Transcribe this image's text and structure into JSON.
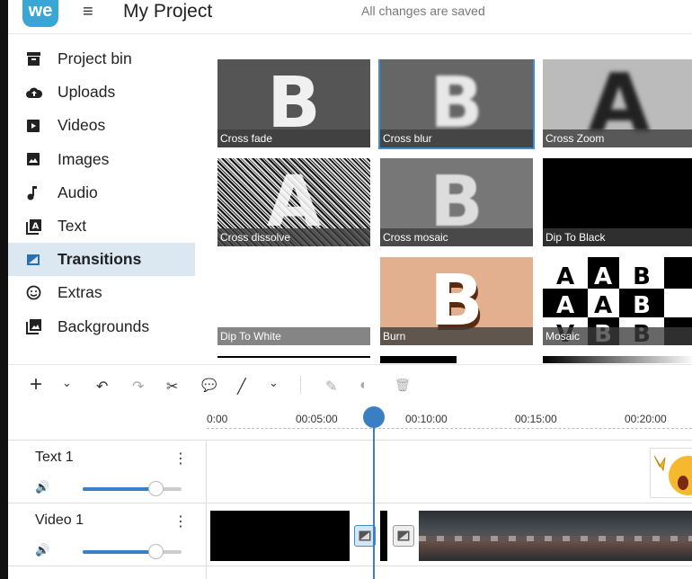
{
  "header": {
    "logo_text": "we",
    "menu_icon": "≡",
    "project_title": "My Project",
    "save_status": "All changes are saved"
  },
  "sidebar": {
    "items": [
      {
        "label": "Project bin",
        "icon": "archive-icon"
      },
      {
        "label": "Uploads",
        "icon": "cloud-upload-icon"
      },
      {
        "label": "Videos",
        "icon": "video-play-icon"
      },
      {
        "label": "Images",
        "icon": "image-icon"
      },
      {
        "label": "Audio",
        "icon": "music-note-icon"
      },
      {
        "label": "Text",
        "icon": "text-box-icon"
      },
      {
        "label": "Transitions",
        "icon": "transition-icon",
        "active": true
      },
      {
        "label": "Extras",
        "icon": "smiley-icon"
      },
      {
        "label": "Backgrounds",
        "icon": "backgrounds-icon"
      }
    ]
  },
  "transitions": [
    {
      "label": "Cross fade",
      "glyph": "B"
    },
    {
      "label": "Cross blur",
      "glyph": "B",
      "selected": true
    },
    {
      "label": "Cross Zoom",
      "glyph": "A"
    },
    {
      "label": "Cross dissolve",
      "glyph": "A"
    },
    {
      "label": "Cross mosaic",
      "glyph": "B"
    },
    {
      "label": "Dip To Black",
      "glyph": ""
    },
    {
      "label": "Dip To White",
      "glyph": ""
    },
    {
      "label": "Burn",
      "glyph": "B"
    },
    {
      "label": "Mosaic",
      "glyph": ""
    }
  ],
  "toolbar": {
    "add": "+",
    "dropdown": "⌄",
    "undo": "↶",
    "redo": "↷",
    "split": "✂",
    "comment": "💬",
    "draw": "╱",
    "edit": "✎",
    "color": "◐",
    "delete": "🗑"
  },
  "timeline": {
    "ticks": [
      "0:00",
      "00:05:00",
      "00:10:00",
      "00:15:00",
      "00:20:00"
    ],
    "tracks": [
      {
        "name": "Text 1",
        "menu": "⋮",
        "volume_icon": "🔊",
        "volume": 0.75
      },
      {
        "name": "Video 1",
        "menu": "⋮",
        "volume_icon": "🔊",
        "volume": 0.75
      }
    ]
  },
  "colors": {
    "accent": "#3a7fc4",
    "active_bg": "#dbe7f1",
    "logo": "#3aa6d6"
  }
}
